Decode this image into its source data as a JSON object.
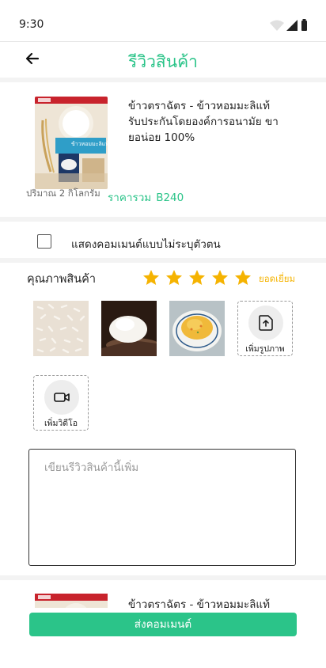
{
  "status_bar": {
    "time": "9:30"
  },
  "header": {
    "title": "รีวิวสินค้า"
  },
  "product": {
    "name": "ข้าวตราฉัตร - ข้าวหอมมะลิแท้ รับประกันโดยองค์การอนามัย ขายอน่อย 100%",
    "quantity": "ปริมาณ 2 กิโลกรัม",
    "total_label": "ราคารวม",
    "total_value": "B240",
    "package_text": "ข้าวหอมมะลิแท้"
  },
  "anonymous": {
    "label": "แสดงคอมเมนต์แบบไม่ระบุตัวตน",
    "checked": false
  },
  "quality": {
    "label": "คุณภาพสินค้า",
    "rating": 5,
    "max_rating": 5,
    "rating_text": "ยอดเยี่ยม",
    "star_color": "#f5b301"
  },
  "media": {
    "photos": [
      "raw-rice-photo",
      "cooked-rice-spoon-photo",
      "fried-rice-photo"
    ],
    "add_photo_label": "เพิ่มรูปภาพ",
    "add_video_label": "เพิ่มวิดีโอ"
  },
  "review": {
    "placeholder": "เขียนรีวิวสินค้านี้เพิ่ม"
  },
  "product_2": {
    "name": "ข้าวตราฉัตร - ข้าวหอมมะลิแท้"
  },
  "submit": {
    "label": "ส่งคอมเมนต์"
  },
  "colors": {
    "accent": "#2bc489",
    "star": "#f5b301",
    "text": "#222222",
    "placeholder": "#9a9a9a"
  }
}
